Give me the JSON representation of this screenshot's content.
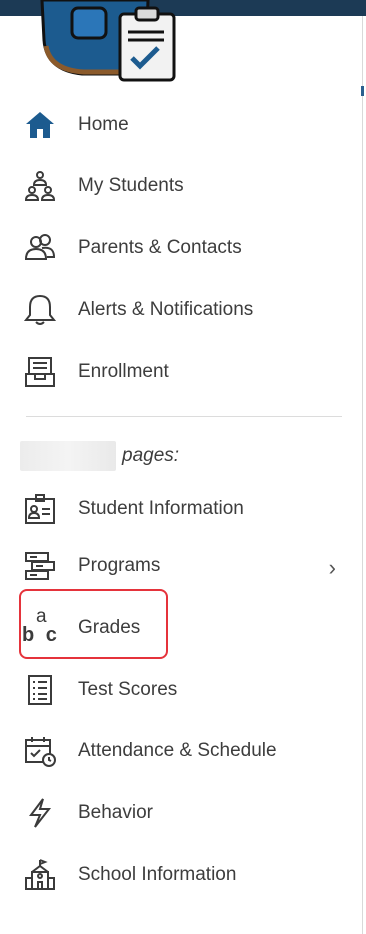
{
  "nav": {
    "home": "Home",
    "my_students": "My Students",
    "parents_contacts": "Parents & Contacts",
    "alerts": "Alerts & Notifications",
    "enrollment": "Enrollment",
    "section_label": "pages:",
    "student_information": "Student Information",
    "programs": "Programs",
    "programs_chevron": "›",
    "grades": "Grades",
    "grades_icon_top": "a",
    "grades_icon_bottom": "b c",
    "test_scores": "Test Scores",
    "attendance_schedule": "Attendance & Schedule",
    "behavior": "Behavior",
    "school_information": "School Information"
  },
  "colors": {
    "accent": "#1c5b8f",
    "highlight": "#e5333b",
    "icon_gray": "#3b3b3b",
    "topbar": "#1c3a55"
  }
}
